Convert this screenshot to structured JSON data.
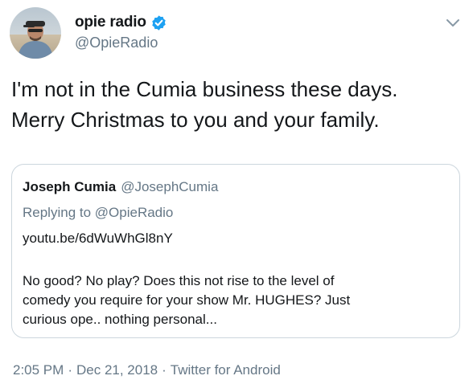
{
  "author": {
    "display_name": "opie radio",
    "handle": "@OpieRadio",
    "verified_icon": "verified-badge-icon",
    "avatar_icon": "profile-photo"
  },
  "tweet": {
    "text_lines": [
      "I'm not in the Cumia business these days.",
      "Merry Christmas to you and your family."
    ]
  },
  "quoted_tweet": {
    "display_name": "Joseph Cumia",
    "handle": "@JosephCumia",
    "replying_to": "Replying to @OpieRadio",
    "link": "youtu.be/6dWuWhGl8nY",
    "text_lines": [
      "No good? No play? Does this not rise to the level of",
      "comedy you require for your show Mr. HUGHES? Just",
      "curious ope.. nothing personal..."
    ]
  },
  "meta": {
    "time": "2:05 PM",
    "separator": "·",
    "date": "Dec 21, 2018",
    "source": "Twitter for Android"
  },
  "menu": {
    "icon": "chevron-down-icon"
  },
  "colors": {
    "text": "#14171a",
    "secondary": "#657786",
    "verified": "#1da1f2",
    "border": "#ccd6dd"
  }
}
